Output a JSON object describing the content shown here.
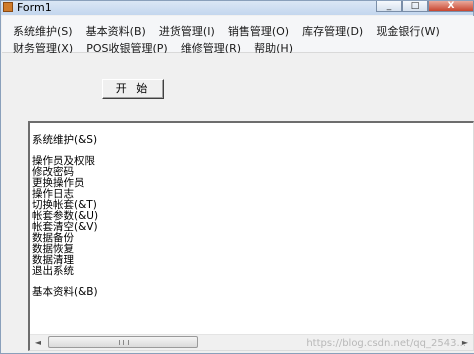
{
  "window": {
    "title": "Form1"
  },
  "caption_buttons": {
    "minimize": "_",
    "maximize": "□",
    "close": "X"
  },
  "menu": {
    "row1": [
      "系统维护(S)",
      "基本资料(B)",
      "进货管理(I)",
      "销售管理(O)",
      "库存管理(D)",
      "现金银行(W)"
    ],
    "row2": [
      "财务管理(X)",
      "POS收银管理(P)",
      "维修管理(R)",
      "帮助(H)"
    ]
  },
  "start_button": {
    "label": "开 始"
  },
  "list": {
    "items": [
      "系统维护(&S)",
      "",
      "操作员及权限",
      "修改密码",
      "更换操作员",
      "操作日志",
      "切换帐套(&T)",
      "帐套参数(&U)",
      "帐套清空(&V)",
      "数据备份",
      "数据恢复",
      "数据清理",
      "退出系统",
      "",
      "基本资料(&B)"
    ]
  },
  "scrollbar": {
    "left_arrow": "◄",
    "right_arrow": "►"
  },
  "watermark": "https://blog.csdn.net/qq_2543..."
}
